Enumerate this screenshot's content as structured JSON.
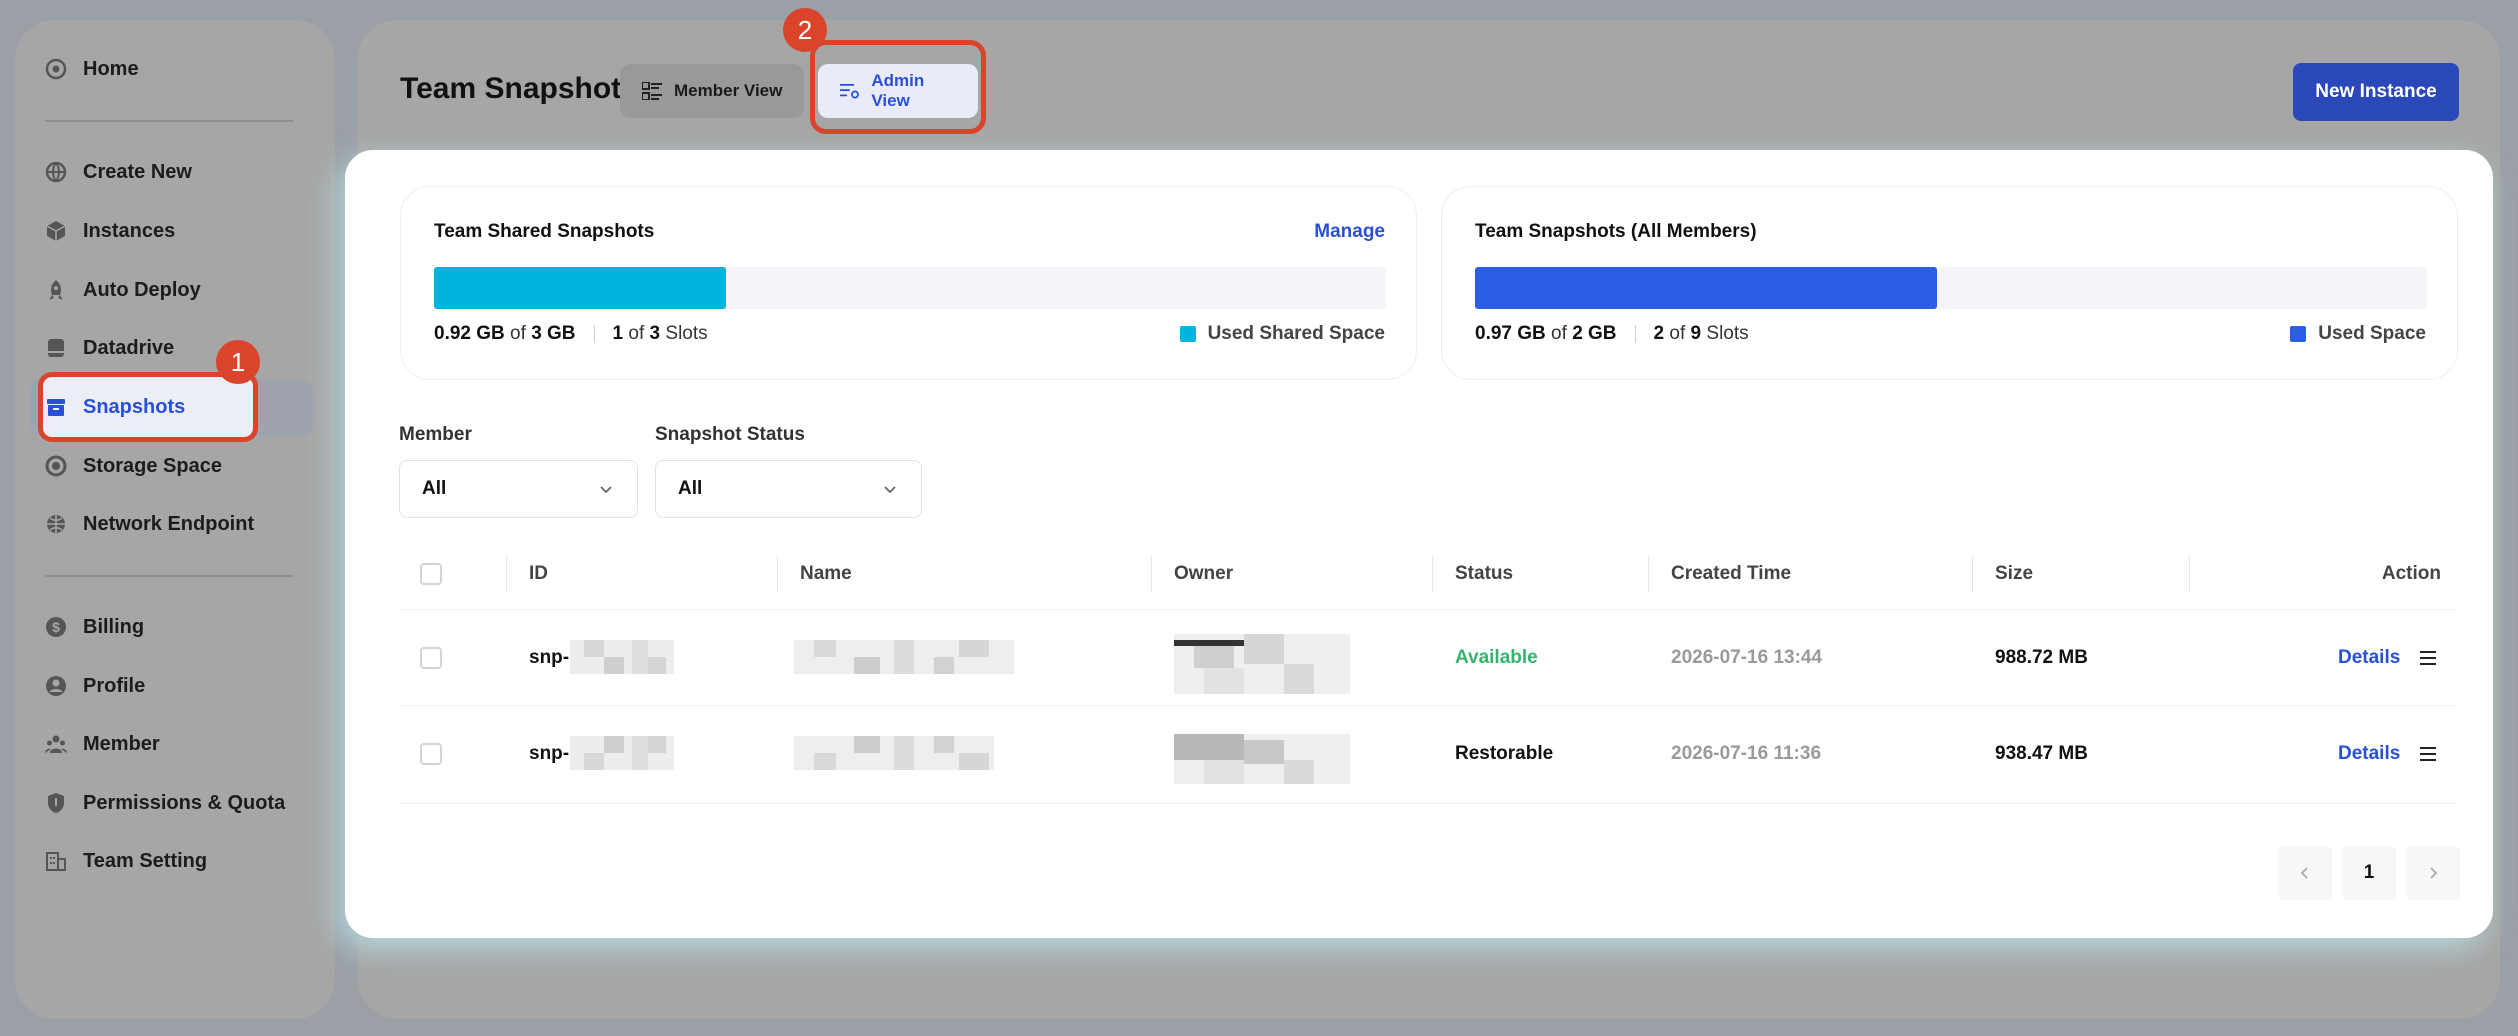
{
  "sidebar": {
    "items": [
      {
        "label": "Home",
        "icon": "home-icon"
      },
      {
        "label": "Create New",
        "icon": "globe-icon"
      },
      {
        "label": "Instances",
        "icon": "cube-icon"
      },
      {
        "label": "Auto Deploy",
        "icon": "rocket-icon"
      },
      {
        "label": "Datadrive",
        "icon": "drive-icon"
      },
      {
        "label": "Snapshots",
        "icon": "archive-icon"
      },
      {
        "label": "Storage Space",
        "icon": "disk-icon"
      },
      {
        "label": "Network Endpoint",
        "icon": "network-icon"
      },
      {
        "label": "Billing",
        "icon": "dollar-icon"
      },
      {
        "label": "Profile",
        "icon": "user-icon"
      },
      {
        "label": "Member",
        "icon": "members-icon"
      },
      {
        "label": "Permissions & Quota",
        "icon": "shield-icon"
      },
      {
        "label": "Team Setting",
        "icon": "building-icon"
      }
    ],
    "active": "Snapshots"
  },
  "header": {
    "title": "Team Snapshots",
    "tab_member": "Member View",
    "tab_admin": "Admin View",
    "new_instance": "New Instance"
  },
  "annotations": {
    "badge1": "1",
    "badge2": "2"
  },
  "shared": {
    "title": "Team Shared Snapshots",
    "manage": "Manage",
    "used": "0.92 GB",
    "of_word": "of",
    "total": "3 GB",
    "slots_used": "1",
    "slots_total": "3",
    "slots_word": "Slots",
    "legend": "Used Shared Space",
    "fill_fraction": 0.307,
    "color": "#00b4e0"
  },
  "all_members": {
    "title": "Team Snapshots (All Members)",
    "used": "0.97 GB",
    "of_word": "of",
    "total": "2 GB",
    "slots_used": "2",
    "slots_total": "9",
    "slots_word": "Slots",
    "legend": "Used Space",
    "fill_fraction": 0.485,
    "color": "#2c5de5"
  },
  "filters": {
    "member_label": "Member",
    "member_value": "All",
    "status_label": "Snapshot Status",
    "status_value": "All"
  },
  "table": {
    "columns": [
      "ID",
      "Name",
      "Owner",
      "Status",
      "Created Time",
      "Size",
      "Action"
    ],
    "rows": [
      {
        "id": "snp-",
        "status": "Available",
        "created": "2026-07-16 13:44",
        "size": "988.72 MB",
        "action": "Details"
      },
      {
        "id": "snp-",
        "status": "Restorable",
        "created": "2026-07-16 11:36",
        "size": "938.47 MB",
        "action": "Details"
      }
    ]
  },
  "pagination": {
    "page": "1"
  }
}
